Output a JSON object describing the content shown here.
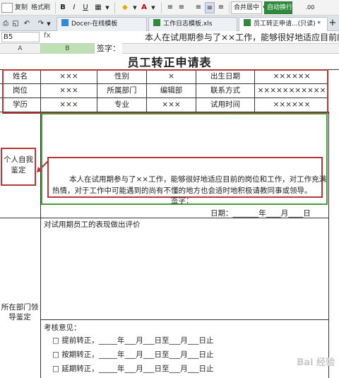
{
  "ribbon": {
    "copy": "复制",
    "format_painter": "格式刷",
    "bold": "B",
    "italic": "I",
    "underline": "U",
    "font_color_glyph": "A",
    "merge_center": "合并居中",
    "wrap_text": "自动换行",
    "decimal": ".00"
  },
  "tabs": [
    {
      "label": "Docer-在线模板"
    },
    {
      "label": "工作日志模板.xls"
    },
    {
      "label": "员工转正申请...(只读) *"
    }
  ],
  "formula": {
    "name_box": "B5",
    "fx": "fx",
    "content": "本人在试用期参与了××工作，能够很好地适应目前的"
  },
  "columns": [
    "A",
    "B"
  ],
  "header_overlay": "签字：",
  "form": {
    "title": "员工转正申请表",
    "rows": [
      [
        "姓名",
        "×××",
        "性别",
        "×",
        "出生日期",
        "××××××"
      ],
      [
        "岗位",
        "×××",
        "所属部门",
        "编辑部",
        "联系方式",
        "×××××××××××"
      ],
      [
        "学历",
        "×××",
        "专业",
        "×××",
        "试用时间",
        "××××××"
      ]
    ],
    "self_eval_label": "个人自我鉴定",
    "self_eval_text": "本人在试用期参与了××工作，能够很好地适应目前的岗位和工作，对工作充满热情，对于工作中可能遇到的尚有不懂的地方也会适时地积极请教同事或领导。",
    "sign_label": "签字：",
    "date_label": "日期：_______年____月____日",
    "dept_eval_label": "所在部门领导鉴定",
    "dept_eval_prompt": "对试用期员工的表现做出评价",
    "review_label": "考核意见：",
    "options": [
      "□ 提前转正，_____年___月___日至___月___日止",
      "□ 按期转正，_____年___月___日至___月___日止",
      "□ 延期转正，_____年___月___日至___月___日止"
    ]
  },
  "watermark": "Bai 经验",
  "colors": {
    "red_box": "#b8363a",
    "green_box": "#4a9a3a",
    "merge_button": "#2f8a3d",
    "selected_column": "#bfe0b5"
  }
}
